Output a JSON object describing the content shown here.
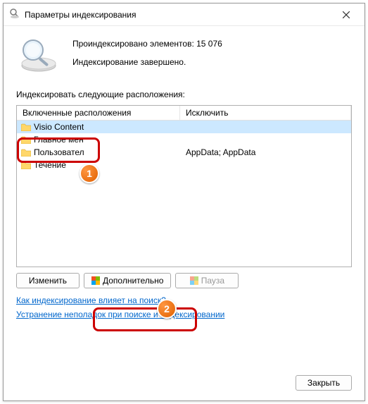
{
  "window": {
    "title": "Параметры индексирования"
  },
  "summary": {
    "line1": "Проиндексировано элементов: 15 076",
    "line2": "Индексирование завершено."
  },
  "subheading": "Индексировать следующие расположения:",
  "columns": {
    "included": "Включенные расположения",
    "excluded": "Исключить"
  },
  "rows": [
    {
      "name": "Visio Content",
      "exclude": "",
      "selected": true
    },
    {
      "name": "Главное мен",
      "exclude": "",
      "selected": false
    },
    {
      "name": "Пользовател",
      "exclude": "AppData; AppData",
      "selected": false
    },
    {
      "name": "Течение",
      "exclude": "",
      "selected": false
    }
  ],
  "buttons": {
    "modify": "Изменить",
    "advanced": "Дополнительно",
    "pause": "Пауза",
    "close": "Закрыть"
  },
  "links": {
    "how": "Как индексирование влияет на поиск?",
    "troubleshoot": "Устранение неполадок при поиске и индексировании"
  },
  "annotations": {
    "badge1": "1",
    "badge2": "2"
  }
}
